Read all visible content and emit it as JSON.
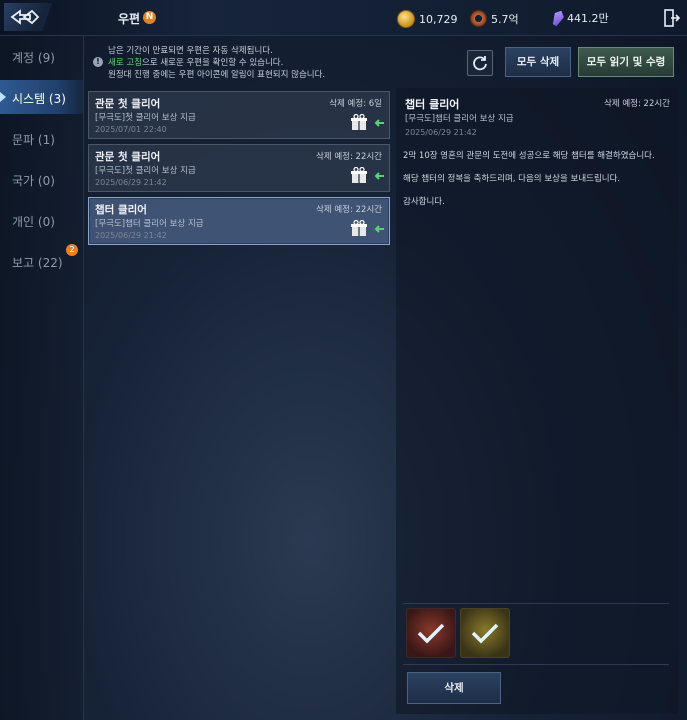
{
  "header": {
    "title": "우편",
    "new_badge": "N",
    "currencies": [
      {
        "icon": "gold-coin-icon",
        "value": "10,729"
      },
      {
        "icon": "donut-currency-icon",
        "value": "5.7억"
      },
      {
        "icon": "crystal-icon",
        "value": "441.2만"
      }
    ],
    "exit_icon": "exit-door-icon"
  },
  "sidebar": {
    "items": [
      {
        "label": "계정 (9)",
        "active": false
      },
      {
        "label": "시스템 (3)",
        "active": true
      },
      {
        "label": "문파 (1)",
        "active": false
      },
      {
        "label": "국가 (0)",
        "active": false
      },
      {
        "label": "개인 (0)",
        "active": false
      },
      {
        "label": "보고 (22)",
        "active": false
      }
    ],
    "report_badge": "2"
  },
  "notice": {
    "line1": "남은 기간이 만료되면 우편은 자동 삭제됩니다.",
    "line2_highlight": "새로 고침",
    "line2_rest": "으로 새로운 우편을 확인할 수 있습니다.",
    "line3": "원정대 진행 중에는 우편 아이콘에 알림이 표현되지 않습니다."
  },
  "actions": {
    "delete_all": "모두 삭제",
    "read_all": "모두 읽기 및 수령"
  },
  "mails": [
    {
      "title": "관문 첫 클리어",
      "subtitle": "[무극도]첫 클리어 보상 지급",
      "date": "2025/07/01 22:40",
      "expire": "삭제 예정: 6일"
    },
    {
      "title": "관문 첫 클리어",
      "subtitle": "[무극도]첫 클리어 보상 지급",
      "date": "2025/06/29 21:42",
      "expire": "삭제 예정: 22시간"
    },
    {
      "title": "챕터 클리어",
      "subtitle": "[무극도]챕터 클리어 보상 지급",
      "date": "2025/06/29 21:42",
      "expire": "삭제 예정: 22시간"
    }
  ],
  "detail": {
    "title": "챕터 클리어",
    "expire": "삭제 예정: 22시간",
    "subtitle": "[무극도]챕터 클리어 보상 지급",
    "date": "2025/06/29 21:42",
    "body": [
      "2막 10장 영혼의 관문의 도전에 성공으로 해당 챕터를 해결하였습니다.",
      "해당 챕터의 정복을 축하드리며, 다음의 보상을 보내드립니다.",
      "감사합니다."
    ],
    "delete_label": "삭제"
  }
}
